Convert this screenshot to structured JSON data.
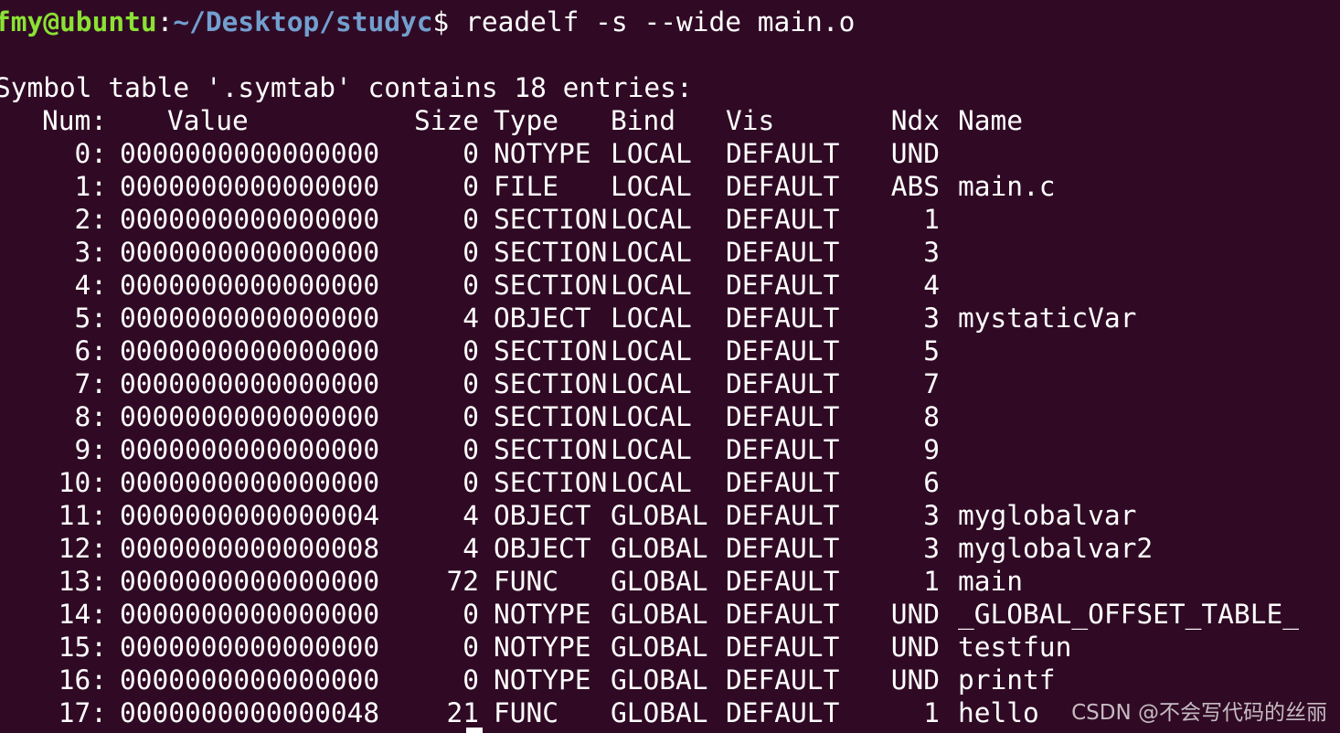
{
  "prompt": {
    "user_host": "fmy@ubuntu",
    "colon": ":",
    "path": "~/Desktop/studyc",
    "symbol": "$ ",
    "command": "readelf -s --wide main.o"
  },
  "heading": "Symbol table '.symtab' contains 18 entries:",
  "columns": {
    "num": "Num:",
    "value": "Value",
    "size": "Size",
    "type": "Type",
    "bind": "Bind",
    "vis": "Vis",
    "ndx": "Ndx",
    "name": "Name"
  },
  "rows": [
    {
      "num": "0:",
      "value": "0000000000000000",
      "size": "0",
      "type": "NOTYPE",
      "bind": "LOCAL",
      "vis": "DEFAULT",
      "ndx": "UND",
      "name": ""
    },
    {
      "num": "1:",
      "value": "0000000000000000",
      "size": "0",
      "type": "FILE",
      "bind": "LOCAL",
      "vis": "DEFAULT",
      "ndx": "ABS",
      "name": "main.c"
    },
    {
      "num": "2:",
      "value": "0000000000000000",
      "size": "0",
      "type": "SECTION",
      "bind": "LOCAL",
      "vis": "DEFAULT",
      "ndx": "1",
      "name": ""
    },
    {
      "num": "3:",
      "value": "0000000000000000",
      "size": "0",
      "type": "SECTION",
      "bind": "LOCAL",
      "vis": "DEFAULT",
      "ndx": "3",
      "name": ""
    },
    {
      "num": "4:",
      "value": "0000000000000000",
      "size": "0",
      "type": "SECTION",
      "bind": "LOCAL",
      "vis": "DEFAULT",
      "ndx": "4",
      "name": ""
    },
    {
      "num": "5:",
      "value": "0000000000000000",
      "size": "4",
      "type": "OBJECT",
      "bind": "LOCAL",
      "vis": "DEFAULT",
      "ndx": "3",
      "name": "mystaticVar"
    },
    {
      "num": "6:",
      "value": "0000000000000000",
      "size": "0",
      "type": "SECTION",
      "bind": "LOCAL",
      "vis": "DEFAULT",
      "ndx": "5",
      "name": ""
    },
    {
      "num": "7:",
      "value": "0000000000000000",
      "size": "0",
      "type": "SECTION",
      "bind": "LOCAL",
      "vis": "DEFAULT",
      "ndx": "7",
      "name": ""
    },
    {
      "num": "8:",
      "value": "0000000000000000",
      "size": "0",
      "type": "SECTION",
      "bind": "LOCAL",
      "vis": "DEFAULT",
      "ndx": "8",
      "name": ""
    },
    {
      "num": "9:",
      "value": "0000000000000000",
      "size": "0",
      "type": "SECTION",
      "bind": "LOCAL",
      "vis": "DEFAULT",
      "ndx": "9",
      "name": ""
    },
    {
      "num": "10:",
      "value": "0000000000000000",
      "size": "0",
      "type": "SECTION",
      "bind": "LOCAL",
      "vis": "DEFAULT",
      "ndx": "6",
      "name": ""
    },
    {
      "num": "11:",
      "value": "0000000000000004",
      "size": "4",
      "type": "OBJECT",
      "bind": "GLOBAL",
      "vis": "DEFAULT",
      "ndx": "3",
      "name": "myglobalvar"
    },
    {
      "num": "12:",
      "value": "0000000000000008",
      "size": "4",
      "type": "OBJECT",
      "bind": "GLOBAL",
      "vis": "DEFAULT",
      "ndx": "3",
      "name": "myglobalvar2"
    },
    {
      "num": "13:",
      "value": "0000000000000000",
      "size": "72",
      "type": "FUNC",
      "bind": "GLOBAL",
      "vis": "DEFAULT",
      "ndx": "1",
      "name": "main"
    },
    {
      "num": "14:",
      "value": "0000000000000000",
      "size": "0",
      "type": "NOTYPE",
      "bind": "GLOBAL",
      "vis": "DEFAULT",
      "ndx": "UND",
      "name": "_GLOBAL_OFFSET_TABLE_"
    },
    {
      "num": "15:",
      "value": "0000000000000000",
      "size": "0",
      "type": "NOTYPE",
      "bind": "GLOBAL",
      "vis": "DEFAULT",
      "ndx": "UND",
      "name": "testfun"
    },
    {
      "num": "16:",
      "value": "0000000000000000",
      "size": "0",
      "type": "NOTYPE",
      "bind": "GLOBAL",
      "vis": "DEFAULT",
      "ndx": "UND",
      "name": "printf"
    },
    {
      "num": "17:",
      "value": "0000000000000048",
      "size": "21",
      "type": "FUNC",
      "bind": "GLOBAL",
      "vis": "DEFAULT",
      "ndx": "1",
      "name": "hello"
    }
  ],
  "watermark": "CSDN @不会写代码的丝丽",
  "colors": {
    "background": "#300a24",
    "foreground": "#ffffff",
    "prompt_user": "#8ae234",
    "prompt_path": "#729fcf"
  }
}
